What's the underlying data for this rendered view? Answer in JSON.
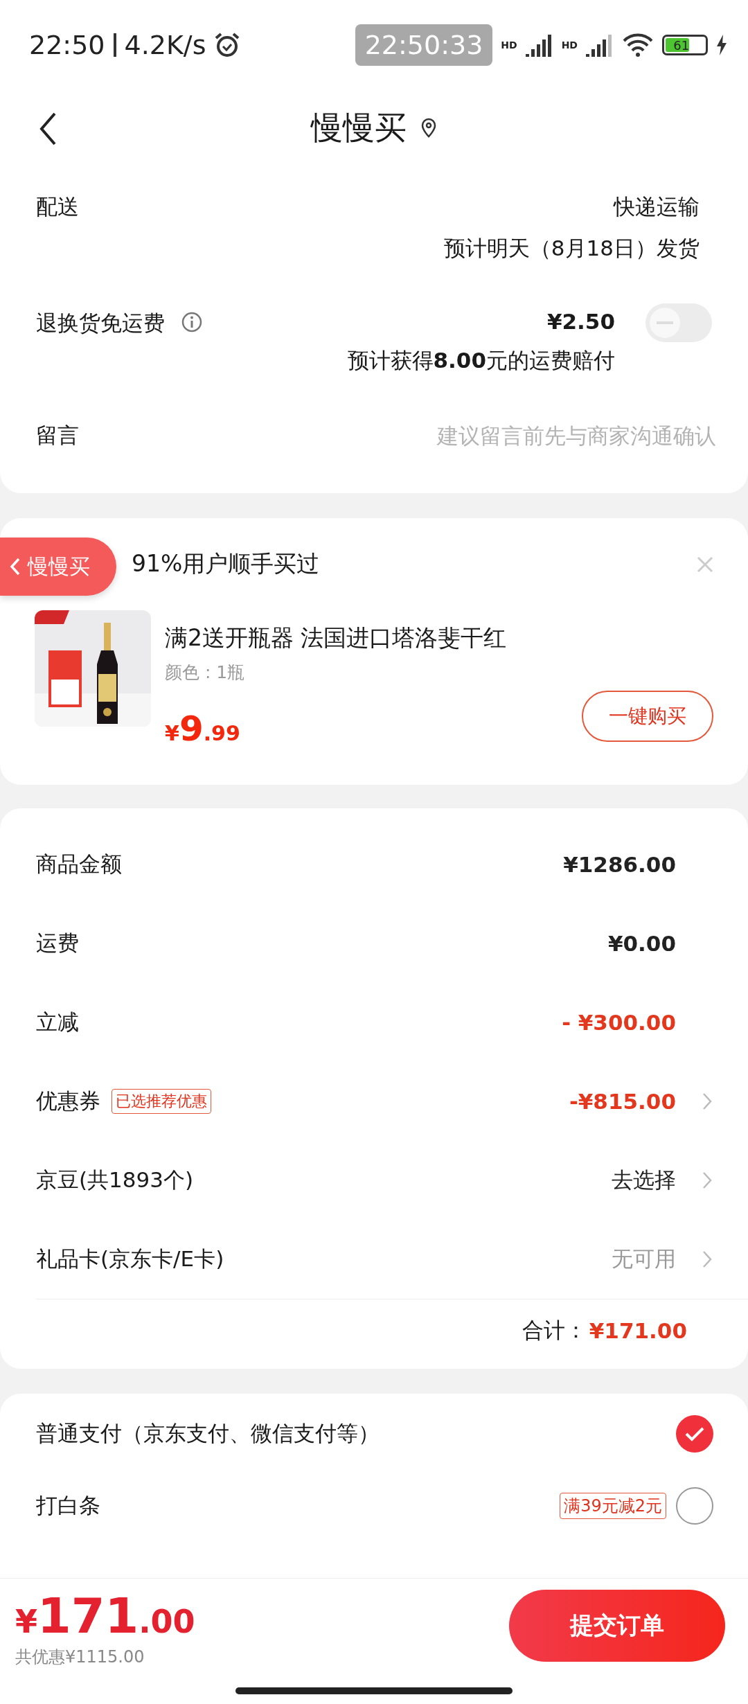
{
  "status_bar": {
    "time": "22:50",
    "speed": "4.2K/s",
    "clock_pill": "22:50:33",
    "network_label": "HD",
    "network_label_2": "HD",
    "battery": "61"
  },
  "header": {
    "title": "慢慢买"
  },
  "delivery_card": {
    "rows": [
      {
        "kind": "delivery",
        "label": "配送",
        "value": "快递运输",
        "note": "预计明天（8月18日）发货"
      },
      {
        "kind": "toggle",
        "label": "退换货免运费",
        "value": "¥2.50",
        "note": "预计获得**8.00**元的运费赔付",
        "on": false
      },
      {
        "kind": "input",
        "label": "留言",
        "placeholder": "建议留言前先与商家沟通确认"
      }
    ]
  },
  "overlay_back": {
    "label": "慢慢买"
  },
  "recommend": {
    "title": "91%用户顺手买过",
    "product": {
      "name": "满2送开瓶器 法国进口塔洛斐干红",
      "variant": "颜色 : 1瓶",
      "price_symbol": "¥",
      "price_int": "9",
      "price_dec": ".99",
      "button": "一键购买"
    }
  },
  "summary": {
    "rows": [
      {
        "kind": "plain",
        "label": "商品金额",
        "value": "¥1286.00",
        "chevron": false
      },
      {
        "kind": "plain",
        "label": "运费",
        "value": "¥0.00",
        "chevron": false
      },
      {
        "kind": "discount",
        "label": "立减",
        "value": "- ¥300.00",
        "chevron": false
      },
      {
        "kind": "discount",
        "label": "优惠券",
        "tag": "已选推荐优惠",
        "value": "-¥815.00",
        "chevron": true
      },
      {
        "kind": "link",
        "label": "京豆(共1893个)",
        "value": "去选择",
        "chevron": true
      },
      {
        "kind": "muted",
        "label": "礼品卡(京东卡/E卡)",
        "value": "无可用",
        "chevron": true
      }
    ],
    "total_label": "合计：",
    "total": "¥171.00"
  },
  "payment": {
    "options": [
      {
        "label": "普通支付（京东支付、微信支付等）",
        "selected": true
      },
      {
        "label": "打白条",
        "tag": "满39元减2元",
        "selected": false
      }
    ]
  },
  "footer": {
    "symbol": "¥",
    "amount_int": "171",
    "amount_dec": ".00",
    "savings": "共优惠¥1115.00",
    "submit": "提交订单"
  }
}
